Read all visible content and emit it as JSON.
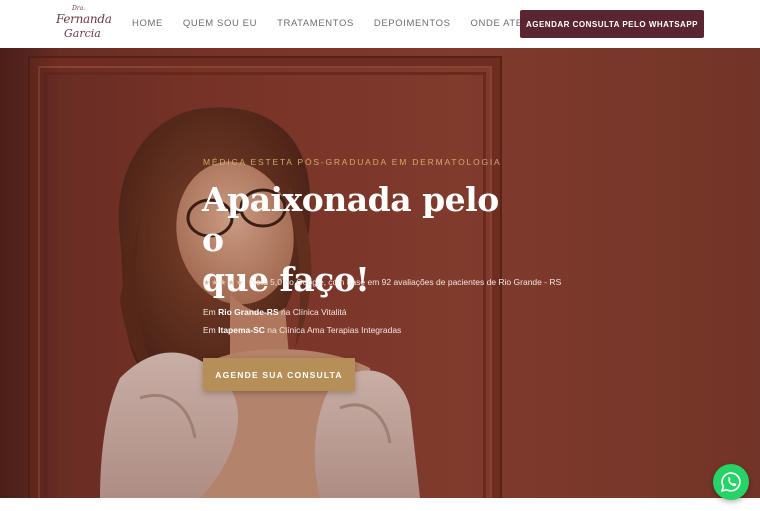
{
  "logo": {
    "small": "Dra.",
    "main": "Fernanda",
    "sub": "Garcia"
  },
  "nav": {
    "items": [
      {
        "label": "HOME"
      },
      {
        "label": "QUEM SOU EU"
      },
      {
        "label": "TRATAMENTOS"
      },
      {
        "label": "DEPOIMENTOS"
      },
      {
        "label": "ONDE ATENDO"
      }
    ],
    "cta_label": "AGENDAR CONSULTA PELO WHATSAPP"
  },
  "hero": {
    "kicker": "MÉDICA ESTETA PÓS-GRADUADA EM DERMATOLOGIA",
    "headline_line1": "Apaixonada pelo o",
    "headline_line2": "que faço!",
    "rating": {
      "stars": "★★★★★",
      "value": 5,
      "text": "Nota 5,0 no Google, com base em 92 avaliações de pacientes de Rio Grande - RS"
    },
    "locations": [
      {
        "prefix": "Em",
        "city": "Rio Grande-RS",
        "suffix": "na Clínica Vitalitá"
      },
      {
        "prefix": "Em",
        "city": "Itapema-SC",
        "suffix": "na Clínica Ama Terapias Integradas"
      }
    ],
    "cta_label": "AGENDE SUA CONSULTA"
  },
  "colors": {
    "brand": "#5a2531",
    "gold": "#b68e57",
    "hero_bg": "#86392c",
    "whatsapp": "#25d366"
  },
  "icons": {
    "whatsapp_fab": "whatsapp-icon"
  }
}
